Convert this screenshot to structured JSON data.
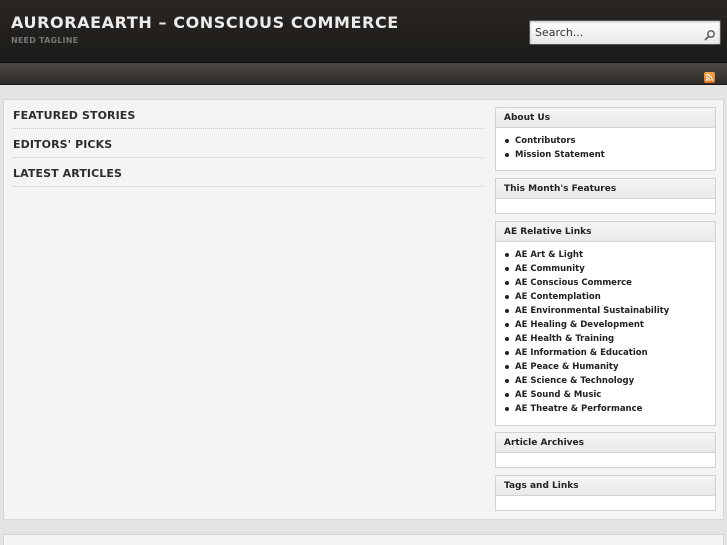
{
  "header": {
    "site_title": "AURORAEARTH – CONSCIOUS COMMERCE",
    "tagline": "NEED TAGLINE",
    "search_placeholder": "Search..."
  },
  "stories": [
    "FEATURED STORIES",
    "EDITORS' PICKS",
    "LATEST ARTICLES"
  ],
  "sidebar": {
    "about": {
      "title": "About Us",
      "items": [
        "Contributors",
        "Mission Statement"
      ]
    },
    "features": {
      "title": "This Month's Features"
    },
    "links": {
      "title": "AE Relative Links",
      "items": [
        "AE Art & Light",
        "AE Community",
        "AE Conscious Commerce",
        "AE Contemplation",
        "AE Environmental Sustainability",
        "AE Healing & Development",
        "AE Health & Training",
        "AE Information & Education",
        "AE Peace & Humanity",
        "AE Science & Technology",
        "AE Sound & Music",
        "AE Theatre & Performance"
      ]
    },
    "archives": {
      "title": "Article Archives"
    },
    "tags": {
      "title": "Tags and Links"
    }
  },
  "icons": {
    "search": "search-icon",
    "rss": "rss-icon"
  },
  "colors": {
    "header_bg": "#211e1c",
    "nav_bg": "#3c3936",
    "rss_orange": "#e8832c"
  }
}
